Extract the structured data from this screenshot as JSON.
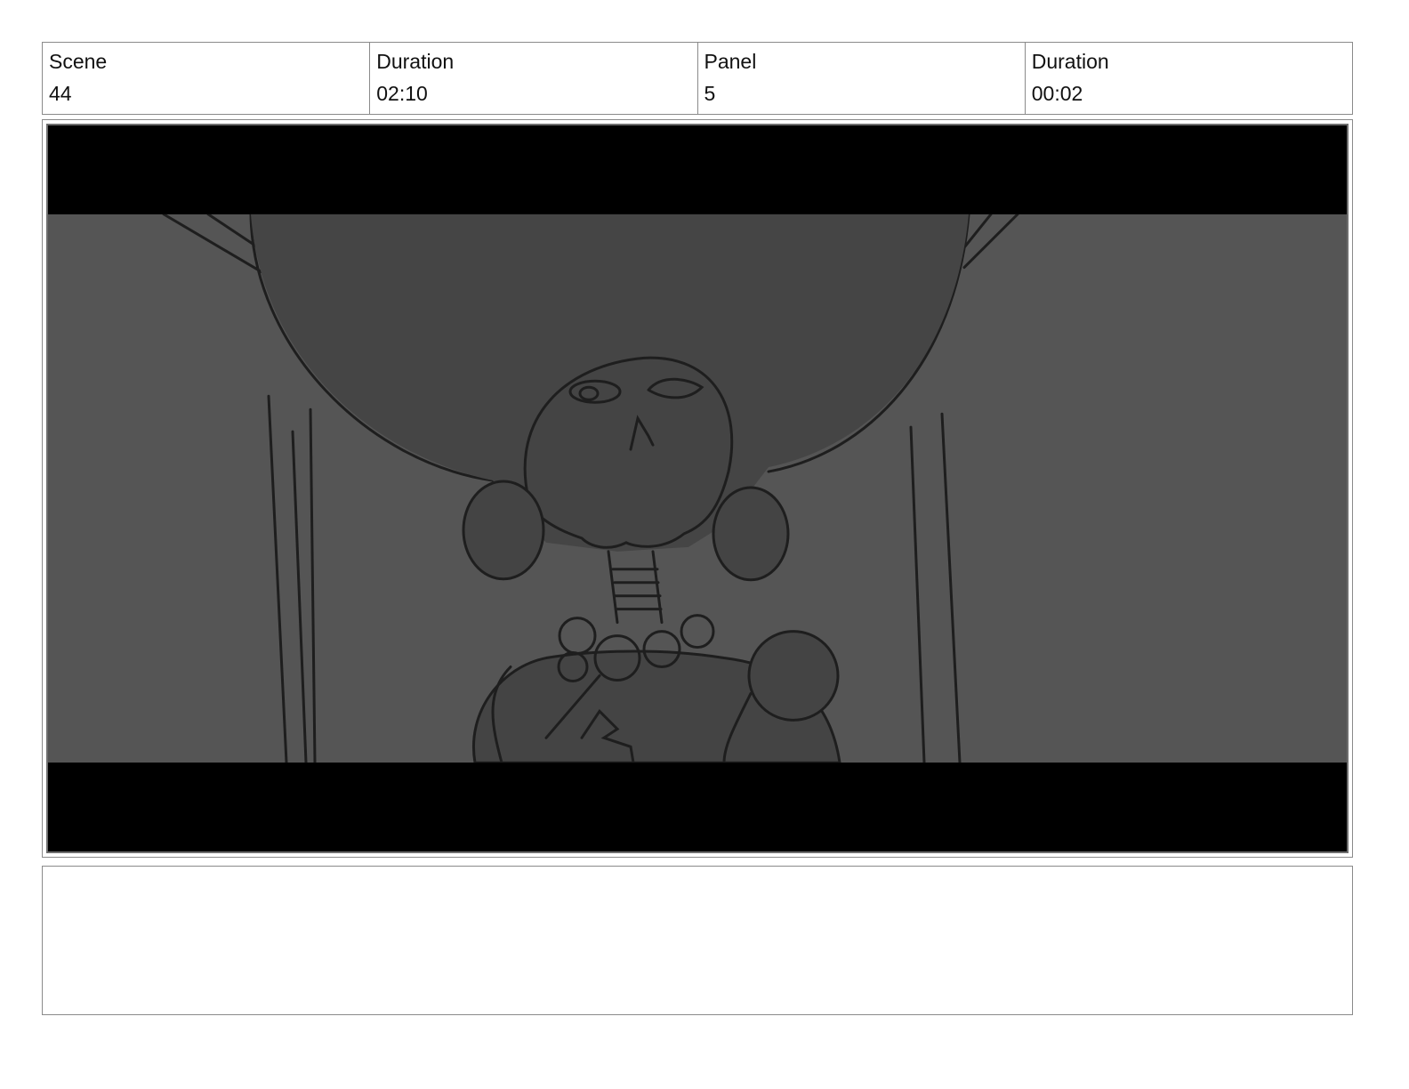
{
  "header": {
    "scene_label": "Scene",
    "scene_value": "44",
    "scene_duration_label": "Duration",
    "scene_duration_value": "02:10",
    "panel_label": "Panel",
    "panel_value": "5",
    "panel_duration_label": "Duration",
    "panel_duration_value": "00:02"
  },
  "panel_image": {
    "subject": "storyboard sketch, skeleton figure with large feathered headdress, earrings and bead necklace, letterboxed",
    "colors": {
      "letterbox": "#000000",
      "background": "#555555",
      "fill": "#444444",
      "line": "#1e1e1e"
    }
  },
  "notes": {
    "text": ""
  }
}
